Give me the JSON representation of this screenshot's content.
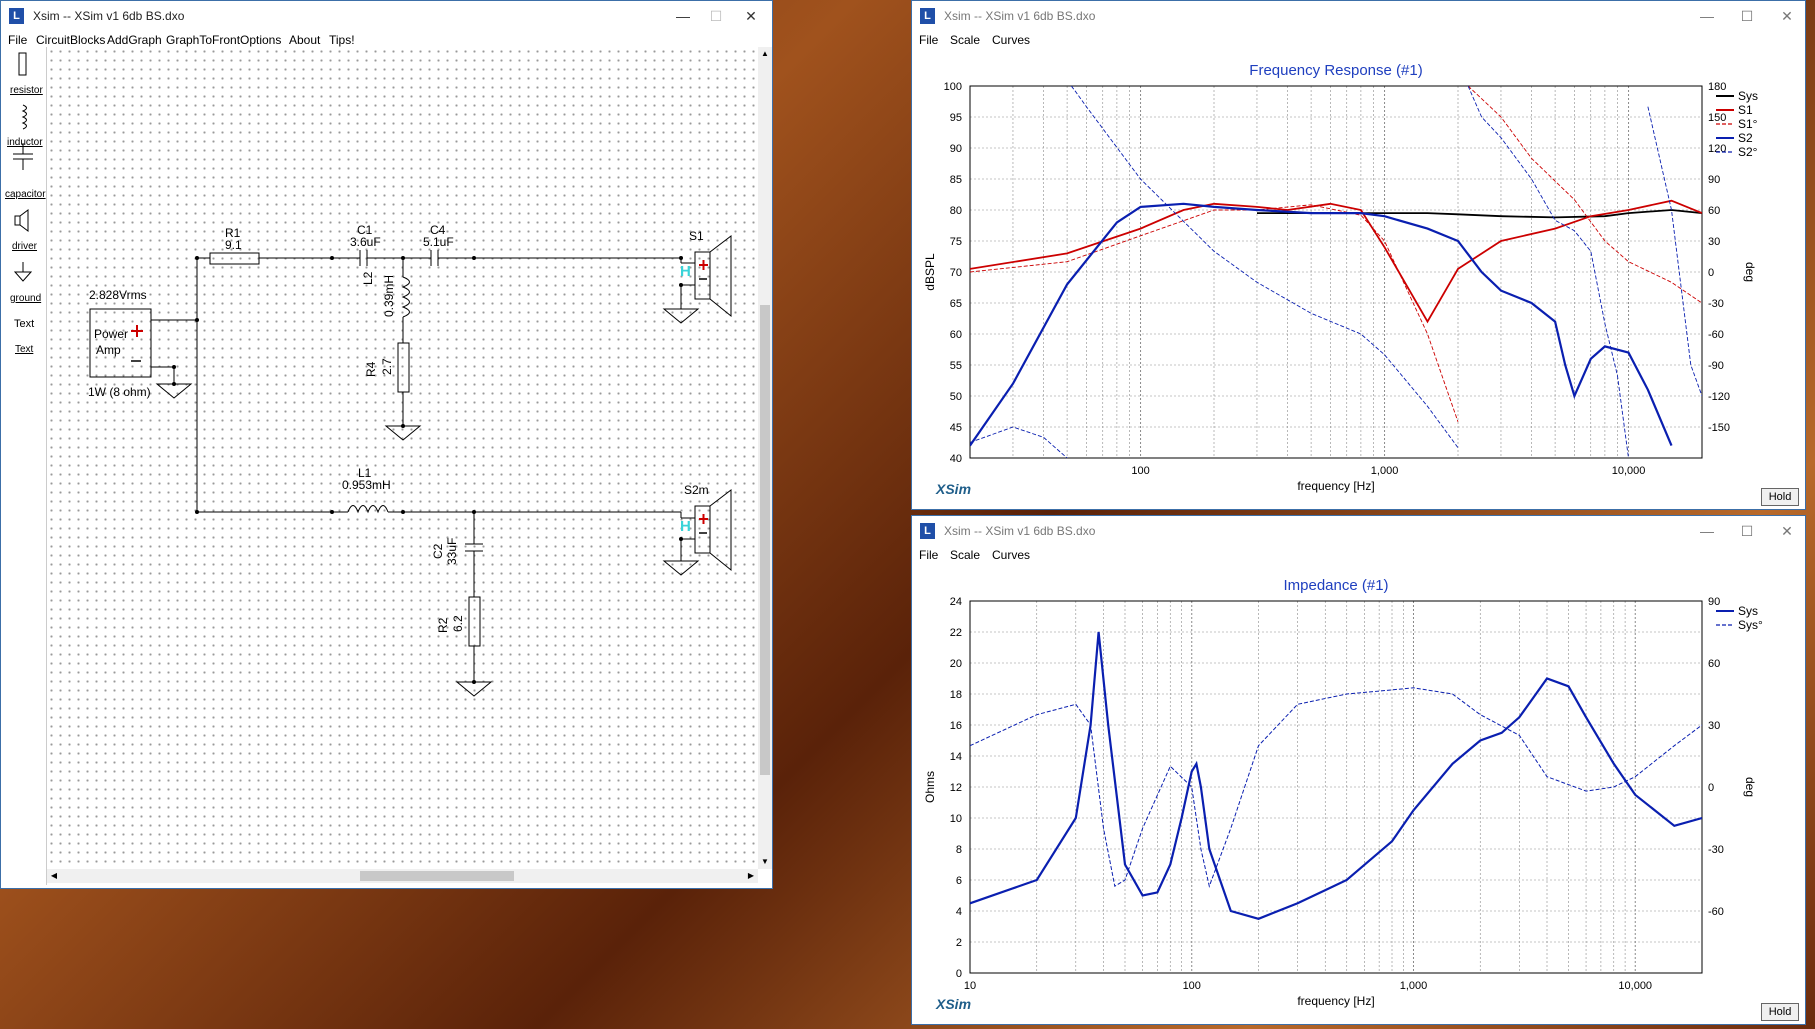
{
  "left": {
    "title": "Xsim -- XSim v1 6db BS.dxo",
    "menu": [
      "File",
      "CircuitBlocks",
      "AddGraph",
      "GraphToFront",
      "Options",
      "About",
      "Tips!"
    ],
    "palette": [
      "resistor",
      "inductor",
      "capacitor",
      "driver",
      "ground",
      "Text",
      "Text"
    ],
    "amp": {
      "title": "2.828Vrms",
      "l1": "Power",
      "l2": "Amp",
      "foot": "1W (8 ohm)"
    },
    "r1": {
      "name": "R1",
      "val": "9.1"
    },
    "c1": {
      "name": "C1",
      "val": "3.6uF"
    },
    "c4": {
      "name": "C4",
      "val": "5.1uF"
    },
    "l2": {
      "name": "L2",
      "val": "0.39mH"
    },
    "r4": {
      "name": "R4",
      "val": "2.7"
    },
    "l1": {
      "name": "L1",
      "val": "0.953mH"
    },
    "c2": {
      "name": "C2",
      "val": "33uF"
    },
    "r2": {
      "name": "R2",
      "val": "6.2"
    },
    "s1": "S1",
    "s2m": "S2m",
    "h": "H"
  },
  "fr": {
    "title": "Xsim -- XSim v1 6db BS.dxo",
    "menu": [
      "File",
      "Scale",
      "Curves"
    ],
    "chart_title": "Frequency Response (#1)",
    "ylabel": "dBSPL",
    "y2label": "deg",
    "xlabel": "frequency [Hz]",
    "yticks": [
      "100",
      "95",
      "90",
      "85",
      "80",
      "75",
      "70",
      "65",
      "60",
      "55",
      "50",
      "45",
      "40"
    ],
    "y2ticks": [
      "180",
      "150",
      "120",
      "90",
      "60",
      "30",
      "0",
      "-30",
      "-60",
      "-90",
      "-120",
      "-150"
    ],
    "xticks": [
      "100",
      "1,000",
      "10,000"
    ],
    "legend": [
      "Sys",
      "S1",
      "S1°",
      "S2",
      "S2°"
    ],
    "brand": "XSim",
    "hold": "Hold"
  },
  "imp": {
    "title": "Xsim -- XSim v1 6db BS.dxo",
    "menu": [
      "File",
      "Scale",
      "Curves"
    ],
    "chart_title": "Impedance (#1)",
    "ylabel": "Ohms",
    "y2label": "deg",
    "xlabel": "frequency [Hz]",
    "yticks": [
      "24",
      "22",
      "20",
      "18",
      "16",
      "14",
      "12",
      "10",
      "8",
      "6",
      "4",
      "2",
      "0"
    ],
    "y2ticks": [
      "90",
      "60",
      "30",
      "0",
      "-30",
      "-60"
    ],
    "xticks": [
      "10",
      "100",
      "1,000",
      "10,000"
    ],
    "legend": [
      "Sys",
      "Sys°"
    ],
    "brand": "XSim",
    "hold": "Hold"
  },
  "colors": {
    "sys": "#000000",
    "s1": "#cc0000",
    "s2": "#0a1fb0",
    "title": "#1f3fbf"
  },
  "chart_data": [
    {
      "type": "line",
      "title": "Frequency Response (#1)",
      "xlabel": "frequency [Hz]",
      "ylabel": "dBSPL",
      "y2label": "deg",
      "xscale": "log",
      "xlim": [
        20,
        20000
      ],
      "ylim": [
        40,
        100
      ],
      "y2lim": [
        -180,
        180
      ],
      "series": [
        {
          "name": "Sys",
          "x": [
            300,
            500,
            800,
            1000,
            1500,
            2000,
            3000,
            5000,
            8000,
            10000,
            15000,
            20000
          ],
          "y": [
            79.5,
            79.5,
            79.5,
            79.5,
            79.5,
            79.3,
            79,
            78.8,
            79,
            79.5,
            80,
            79.5
          ]
        },
        {
          "name": "S1",
          "x": [
            20,
            50,
            100,
            150,
            200,
            300,
            400,
            600,
            800,
            1000,
            1500,
            2000,
            3000,
            5000,
            7000,
            10000,
            15000,
            20000
          ],
          "y": [
            70.5,
            73,
            77,
            80,
            81,
            80.5,
            80,
            81,
            80,
            74,
            62,
            70.5,
            75,
            77,
            79,
            80,
            81.5,
            79.5
          ]
        },
        {
          "name": "S1°",
          "x": [
            20,
            50,
            100,
            200,
            300,
            500,
            800,
            1000,
            1500,
            2000,
            2200,
            3000,
            4000,
            6000,
            8000,
            10000,
            15000,
            20000
          ],
          "y": [
            0,
            10,
            35,
            60,
            60,
            65,
            55,
            30,
            -60,
            -145,
            180,
            150,
            110,
            70,
            30,
            10,
            -10,
            -30
          ]
        },
        {
          "name": "S2",
          "x": [
            20,
            30,
            50,
            80,
            100,
            150,
            200,
            300,
            500,
            800,
            1000,
            1500,
            2000,
            2500,
            3000,
            4000,
            5000,
            5500,
            6000,
            7000,
            8000,
            10000,
            12000,
            15000
          ],
          "y": [
            42,
            52,
            68,
            78,
            80.5,
            81,
            80.5,
            80,
            79.5,
            79.5,
            79,
            77,
            75,
            70,
            67,
            65,
            62,
            55,
            50,
            56,
            58,
            57,
            51,
            42
          ]
        },
        {
          "name": "S2°",
          "x": [
            20,
            30,
            40,
            50,
            52,
            54,
            60,
            100,
            200,
            300,
            500,
            800,
            1000,
            1500,
            2000,
            2200,
            2500,
            3000,
            4000,
            5000,
            6000,
            7000,
            8000,
            9000,
            10000,
            12000,
            15000,
            18000,
            20000
          ],
          "y": [
            -165,
            -150,
            -160,
            -180,
            180,
            175,
            160,
            90,
            20,
            -10,
            -40,
            -60,
            -80,
            -130,
            -170,
            180,
            150,
            130,
            90,
            50,
            40,
            20,
            -50,
            -100,
            -180,
            160,
            60,
            -90,
            -120
          ]
        }
      ]
    },
    {
      "type": "line",
      "title": "Impedance (#1)",
      "xlabel": "frequency [Hz]",
      "ylabel": "Ohms",
      "y2label": "deg",
      "xscale": "log",
      "xlim": [
        10,
        20000
      ],
      "ylim": [
        0,
        24
      ],
      "y2lim": [
        -90,
        90
      ],
      "series": [
        {
          "name": "Sys",
          "x": [
            10,
            20,
            30,
            35,
            38,
            42,
            50,
            60,
            70,
            80,
            90,
            100,
            105,
            110,
            120,
            150,
            200,
            300,
            500,
            800,
            1000,
            1500,
            2000,
            2500,
            3000,
            4000,
            5000,
            6000,
            8000,
            10000,
            15000,
            20000
          ],
          "y": [
            4.5,
            6,
            10,
            16,
            22,
            16,
            7,
            5,
            5.2,
            7,
            10,
            13,
            13.5,
            12,
            8,
            4,
            3.5,
            4.5,
            6,
            8.5,
            10.5,
            13.5,
            15,
            15.5,
            16.5,
            19,
            18.5,
            16.5,
            13.5,
            11.5,
            9.5,
            10
          ]
        },
        {
          "name": "Sys°",
          "x": [
            10,
            20,
            30,
            35,
            40,
            45,
            50,
            60,
            80,
            100,
            110,
            120,
            150,
            200,
            300,
            500,
            800,
            1000,
            1500,
            2000,
            3000,
            4000,
            6000,
            8000,
            10000,
            15000,
            20000
          ],
          "y": [
            20,
            35,
            40,
            30,
            -20,
            -48,
            -45,
            -20,
            10,
            0,
            -30,
            -48,
            -20,
            20,
            40,
            45,
            47,
            48,
            45,
            35,
            25,
            5,
            -2,
            0,
            5,
            20,
            30
          ]
        }
      ]
    }
  ]
}
